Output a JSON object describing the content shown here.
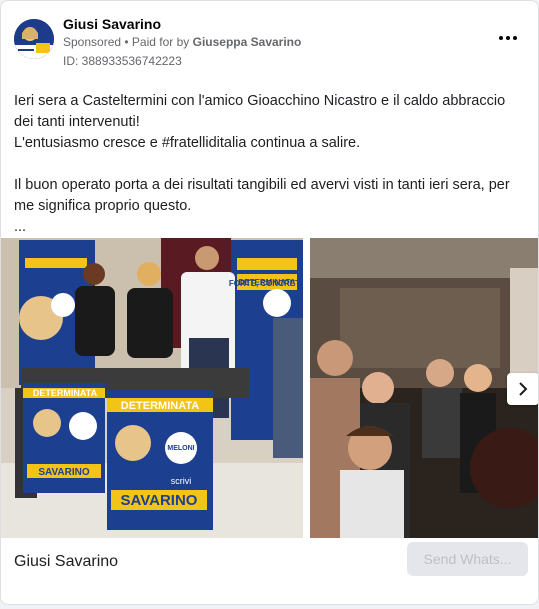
{
  "post": {
    "page_name": "Giusi Savarino",
    "sponsored_label": "Sponsored",
    "paid_for_prefix": " • Paid for by ",
    "paid_for_name": "Giuseppa Savarino",
    "library_id": "ID: 388933536742223",
    "body": "Ieri sera a Casteltermini con l'amico Gioacchino Nicastro e il caldo abbraccio dei tanti intervenuti!\nL'entusiasmo cresce e #fratelliditalia continua a salire.\n\nIl buon operato porta a dei risultati tangibili ed avervi visti in tanti ieri sera, per me significa proprio questo.\n..."
  },
  "media": {
    "poster_top": "FORTE, CONCRETA",
    "poster_big": "DETERMINATA",
    "poster_name": "SAVARINO",
    "poster_scrivi": "scrivi",
    "party_logo": "MELONI",
    "next_icon": "chevron-right-icon"
  },
  "footer": {
    "advertiser": "Giusi Savarino",
    "cta_label": "Send Whats..."
  },
  "colors": {
    "poster_blue": "#1d3f8f",
    "poster_yellow": "#f2c417",
    "cta_bg": "#e4e6eb",
    "cta_text": "#bcc0c4"
  }
}
